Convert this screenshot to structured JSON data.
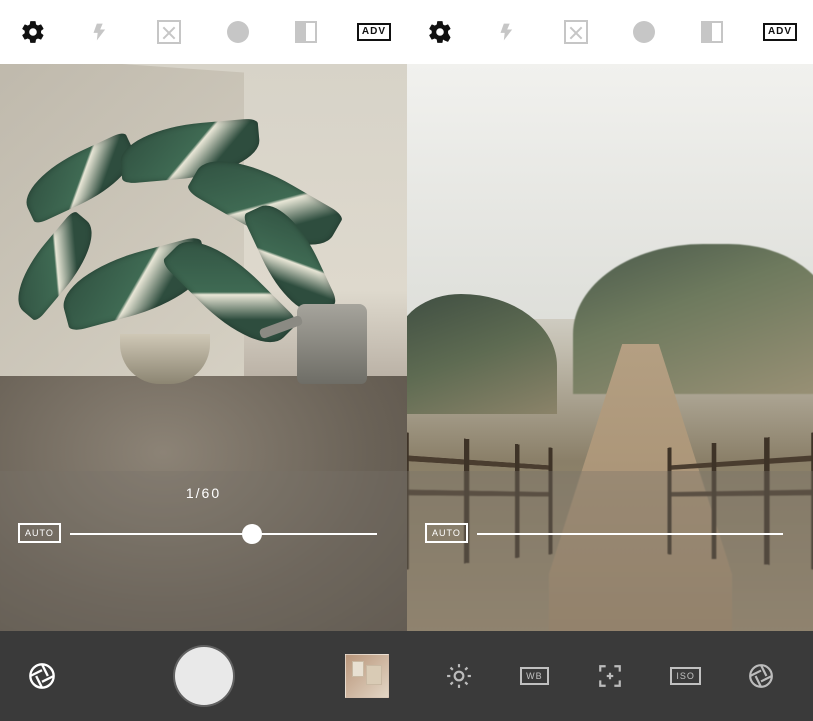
{
  "left": {
    "topbar": {
      "adv_label": "ADV"
    },
    "overlay": {
      "slider_value_label": "1/60",
      "auto_label": "AUTO",
      "slider_position_pct": 56
    }
  },
  "right": {
    "topbar": {
      "adv_label": "ADV"
    },
    "overlay": {
      "slider_value_label": "",
      "auto_label": "AUTO",
      "slider_position_pct": 0
    },
    "bottombar": {
      "wb_label": "WB",
      "iso_label": "ISO"
    }
  }
}
